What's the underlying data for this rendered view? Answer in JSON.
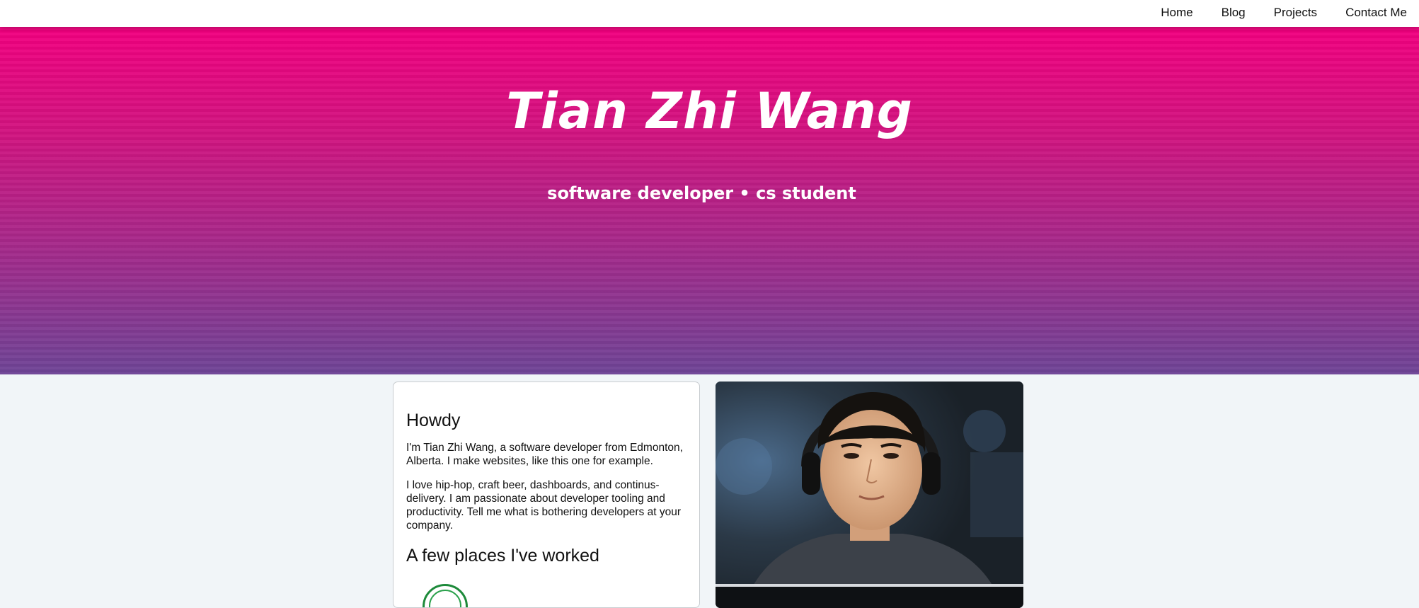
{
  "nav": {
    "items": [
      {
        "label": "Home"
      },
      {
        "label": "Blog"
      },
      {
        "label": "Projects"
      },
      {
        "label": "Contact Me"
      }
    ]
  },
  "hero": {
    "title": "Tian Zhi Wang",
    "subtitle": "software developer • cs student"
  },
  "intro": {
    "heading": "Howdy",
    "paragraph1": "I'm Tian Zhi Wang, a software developer from Edmonton, Alberta. I make websites, like this one for example.",
    "paragraph2": "I love hip-hop, craft beer, dashboards, and continus-delivery. I am passionate about developer tooling and productivity. Tell me what is bothering developers at your company.",
    "work_heading": "A few places I've worked"
  },
  "colors": {
    "hero_top": "#f2007f",
    "hero_bottom": "#6e4496",
    "page_bg": "#f1f5f8",
    "logo_green": "#1d8a3a"
  },
  "icons": {
    "company_logo": "company-logo-icon",
    "portrait": "portrait-photo"
  }
}
